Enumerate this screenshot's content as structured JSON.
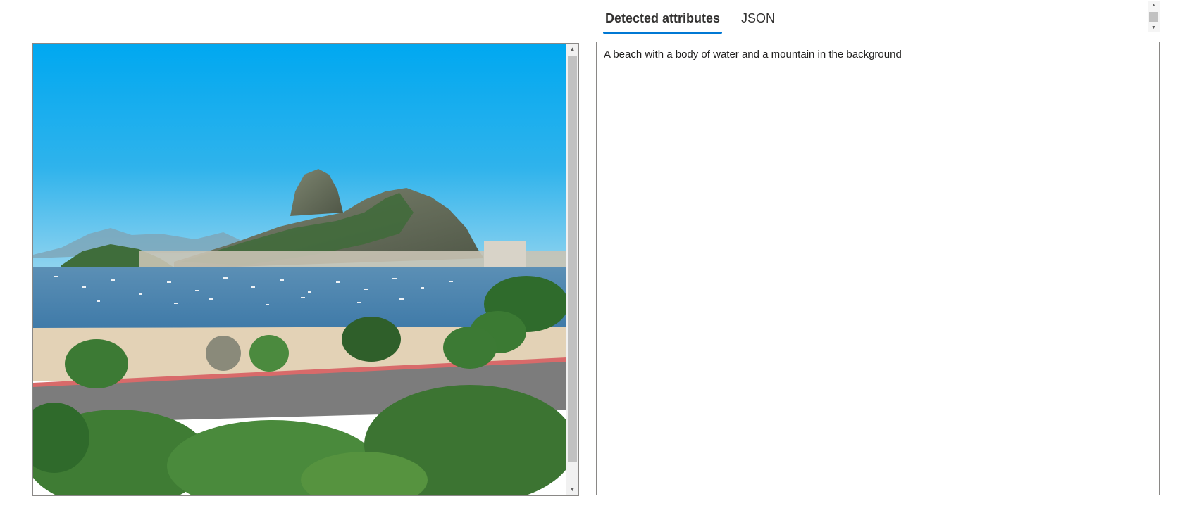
{
  "tabs": {
    "detected_attributes": "Detected attributes",
    "json": "JSON",
    "active": "detected_attributes"
  },
  "result": {
    "caption": "A beach with a body of water and a mountain in the background"
  },
  "colors": {
    "accent": "#0078d4",
    "border": "#8a8886",
    "scrollbar_thumb": "#c1c1c1"
  },
  "icons": {
    "scroll_up": "scroll-up-arrow-icon",
    "scroll_down": "scroll-down-arrow-icon"
  }
}
